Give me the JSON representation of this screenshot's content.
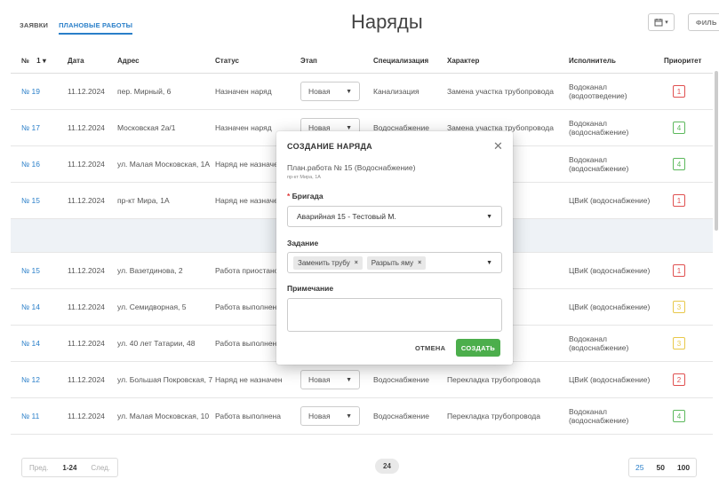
{
  "tabs": [
    {
      "label": "ЗАЯВКИ"
    },
    {
      "label": "ПЛАНОВЫЕ РАБОТЫ"
    }
  ],
  "page_title": "Наряды",
  "toolbar": {
    "calendar_label": "▾",
    "filter_label": "ФИЛЬ"
  },
  "columns": {
    "num": "№",
    "sort": "1 ▾",
    "date": "Дата",
    "address": "Адрес",
    "status": "Статус",
    "stage": "Этап",
    "spec": "Специализация",
    "character": "Характер",
    "executor": "Исполнитель",
    "priority": "Приоритет"
  },
  "rows": [
    {
      "num": "№ 19",
      "date": "11.12.2024",
      "address": "пер. Мирный, 6",
      "status": "Назначен наряд",
      "stage": "Новая",
      "spec": "Канализация",
      "character": "Замена участка трубопровода",
      "executor": "Водоканал (водоотведение)",
      "priority": "1",
      "pcolor": "#e05050"
    },
    {
      "num": "№ 17",
      "date": "11.12.2024",
      "address": "Московская 2а/1",
      "status": "Назначен наряд",
      "stage": "Новая",
      "spec": "Водоснабжение",
      "character": "Замена участка трубопровода",
      "executor": "Водоканал (водоснабжение)",
      "priority": "4",
      "pcolor": "#5cb85c"
    },
    {
      "num": "№ 16",
      "date": "11.12.2024",
      "address": "ул. Малая Московская, 1А",
      "status": "Наряд не назначен",
      "stage": "",
      "spec": "",
      "character": "ровода",
      "executor": "Водоканал (водоснабжение)",
      "priority": "4",
      "pcolor": "#5cb85c"
    },
    {
      "num": "№ 15",
      "date": "11.12.2024",
      "address": "пр-кт Мира, 1А",
      "status": "Наряд не назначен",
      "stage": "",
      "spec": "",
      "character": "ровода",
      "executor": "ЦВиК (водоснабжение)",
      "priority": "1",
      "pcolor": "#e05050"
    },
    {
      "num": "№ 15",
      "date": "11.12.2024",
      "address": "ул. Вазетдинова, 2",
      "status": "Работа приостановлена",
      "stage": "",
      "spec": "",
      "character": "ровода",
      "executor": "ЦВиК (водоснабжение)",
      "priority": "1",
      "pcolor": "#e05050"
    },
    {
      "num": "№ 14",
      "date": "11.12.2024",
      "address": "ул. Семидворная, 5",
      "status": "Работа выполнена",
      "stage": "",
      "spec": "",
      "character": "ровода",
      "executor": "ЦВиК (водоснабжение)",
      "priority": "3",
      "pcolor": "#e8c84a"
    },
    {
      "num": "№ 14",
      "date": "11.12.2024",
      "address": "ул. 40 лет Татарии, 48",
      "status": "Работа выполнена",
      "stage": "",
      "spec": "",
      "character": "бопровода",
      "executor": "Водоканал (водоснабжение)",
      "priority": "3",
      "pcolor": "#e8c84a"
    },
    {
      "num": "№ 12",
      "date": "11.12.2024",
      "address": "ул. Большая Покровская, 7",
      "status": "Наряд не назначен",
      "stage": "Новая",
      "spec": "Водоснабжение",
      "character": "Перекладка трубопровода",
      "executor": "ЦВиК (водоснабжение)",
      "priority": "2",
      "pcolor": "#e05050"
    },
    {
      "num": "№ 11",
      "date": "11.12.2024",
      "address": "ул. Малая Московская, 10",
      "status": "Работа выполнена",
      "stage": "Новая",
      "spec": "Водоснабжение",
      "character": "Перекладка трубопровода",
      "executor": "Водоканал (водоснабжение)",
      "priority": "4",
      "pcolor": "#5cb85c"
    }
  ],
  "footer": {
    "prev": "Пред.",
    "range": "1-24",
    "next": "След.",
    "total": "24",
    "sizes": [
      "25",
      "50",
      "100"
    ]
  },
  "modal": {
    "title": "СОЗДАНИЕ НАРЯДА",
    "subtitle": "План.работа № 15 (Водоснабжение)",
    "subtitle2": "пр-кт Мира, 1А",
    "brigade_label": "Бригада",
    "brigade_value": "Аварийная 15 - Тестовый М.",
    "task_label": "Задание",
    "tasks": [
      "Заменить трубу",
      "Разрыть яму"
    ],
    "note_label": "Примечание",
    "cancel": "ОТМЕНА",
    "create": "СОЗДАТЬ"
  }
}
